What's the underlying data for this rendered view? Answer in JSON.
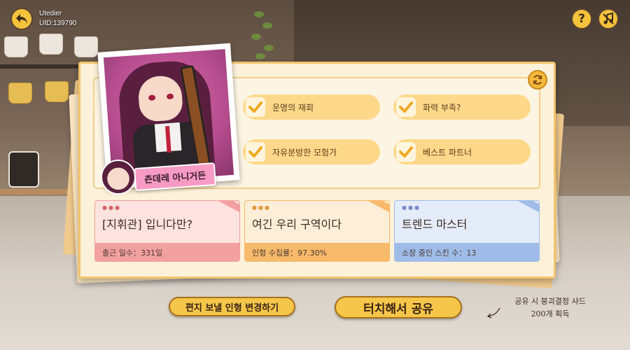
{
  "user": {
    "name": "Utedier",
    "uid": "UID:139790"
  },
  "top_icons": {
    "back": "back-arrow-icon",
    "help": "?",
    "music": "music-off-icon"
  },
  "character_tag": "츤데레 아니거든",
  "traits": [
    {
      "label": "운명의 재회"
    },
    {
      "label": "화력 부족?"
    },
    {
      "label": "자유분방한 모험가"
    },
    {
      "label": "베스트 파트너"
    }
  ],
  "stats": [
    {
      "title": "[지휘관] 입니다만?",
      "detail": "출근 일수：331일",
      "color": "#f2a0a0",
      "bg": "#fde3df",
      "dot": "#d4656a"
    },
    {
      "title": "여긴 우리 구역이다",
      "detail": "인형 수집률：97.30%",
      "color": "#f7b96a",
      "bg": "#fdeed7",
      "dot": "#e29a3c"
    },
    {
      "title": "트렌드 마스터",
      "detail": "소장 중인 스킨 수：13",
      "color": "#9fbce8",
      "bg": "#e4ecf9",
      "dot": "#7c89c9"
    }
  ],
  "actions": {
    "change_doll": "편지 보낼 인형 변경하기",
    "share": "터치해서 공유"
  },
  "reward": {
    "line1": "공유 시 붕괴결정 샤드",
    "line2": "200개 획득"
  },
  "colors": {
    "accent": "#f6c64a",
    "trait_bg": "#fdd88a",
    "check": "#f0a824"
  }
}
